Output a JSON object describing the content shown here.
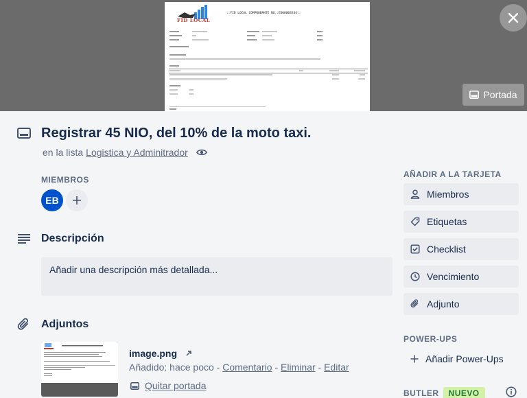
{
  "cover": {
    "doc_logo_text": "FID LOCAL",
    "doc_title": "::FID LOCAL COMPROBANTE NO.:ED00003244::",
    "button_label": "Portada"
  },
  "card": {
    "title": "Registrar 45 NIO, del 10% de la moto taxi.",
    "list_prefix": "en la lista",
    "list_name": "Logistica y Adminitrador"
  },
  "members": {
    "label": "MIEMBROS",
    "avatar_initials": "EB"
  },
  "description": {
    "title": "Descripción",
    "placeholder": "Añadir una descripción más detallada..."
  },
  "attachments": {
    "title": "Adjuntos",
    "file_name": "image.png",
    "added_prefix": "Añadido: hace poco",
    "sep": " - ",
    "comment_link": "Comentario",
    "delete_link": "Eliminar",
    "edit_link": "Editar",
    "remove_cover": "Quitar portada"
  },
  "sidebar": {
    "add_to_card_label": "AÑADIR A LA TARJETA",
    "buttons": [
      {
        "label": "Miembros",
        "icon": "user-icon"
      },
      {
        "label": "Etiquetas",
        "icon": "tag-icon"
      },
      {
        "label": "Checklist",
        "icon": "checklist-icon"
      },
      {
        "label": "Vencimiento",
        "icon": "clock-icon"
      },
      {
        "label": "Adjunto",
        "icon": "paperclip-icon"
      }
    ],
    "powerups_label": "POWER-UPS",
    "add_powerups": "Añadir Power-Ups",
    "butler_label": "BUTLER",
    "butler_badge": "NUEVO"
  },
  "colors": {
    "avatar": "#0052cc",
    "badge_bg": "#d3f1a7",
    "badge_text": "#1f7a3d"
  }
}
